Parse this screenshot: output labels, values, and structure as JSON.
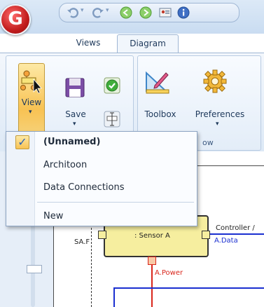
{
  "app": {
    "logo_letter": "G"
  },
  "quick_access": {
    "items": [
      {
        "icon": "undo-icon"
      },
      {
        "icon": "redo-icon"
      },
      {
        "icon": "back-icon"
      },
      {
        "icon": "forward-icon"
      },
      {
        "icon": "contact-card-icon"
      },
      {
        "icon": "info-icon"
      }
    ]
  },
  "tabs": [
    {
      "label": "Views",
      "active": false
    },
    {
      "label": "Diagram",
      "active": true
    }
  ],
  "ribbon": {
    "view_label": "View",
    "save_label": "Save",
    "toolbox_label": "Toolbox",
    "preferences_label": "Preferences",
    "group_b_title_fragment": "ow"
  },
  "view_menu": {
    "items": [
      {
        "label": "(Unnamed)",
        "checked": true,
        "bold": true
      },
      {
        "label": "Architoon",
        "checked": false,
        "bold": false
      },
      {
        "label": "Data Connections",
        "checked": false,
        "bold": false
      }
    ],
    "new_label": "New"
  },
  "diagram": {
    "sensor_label": ": Sensor A",
    "left_port_label": "SA.F",
    "data_port_label": "A.Data",
    "power_port_label": "A.Power",
    "controller_label": "Controller /"
  },
  "colors": {
    "accent_blue": "#2b63b5",
    "sensor_fill": "#f6ee9f",
    "power_red": "#d9261c",
    "data_blue": "#1a2fd0"
  }
}
